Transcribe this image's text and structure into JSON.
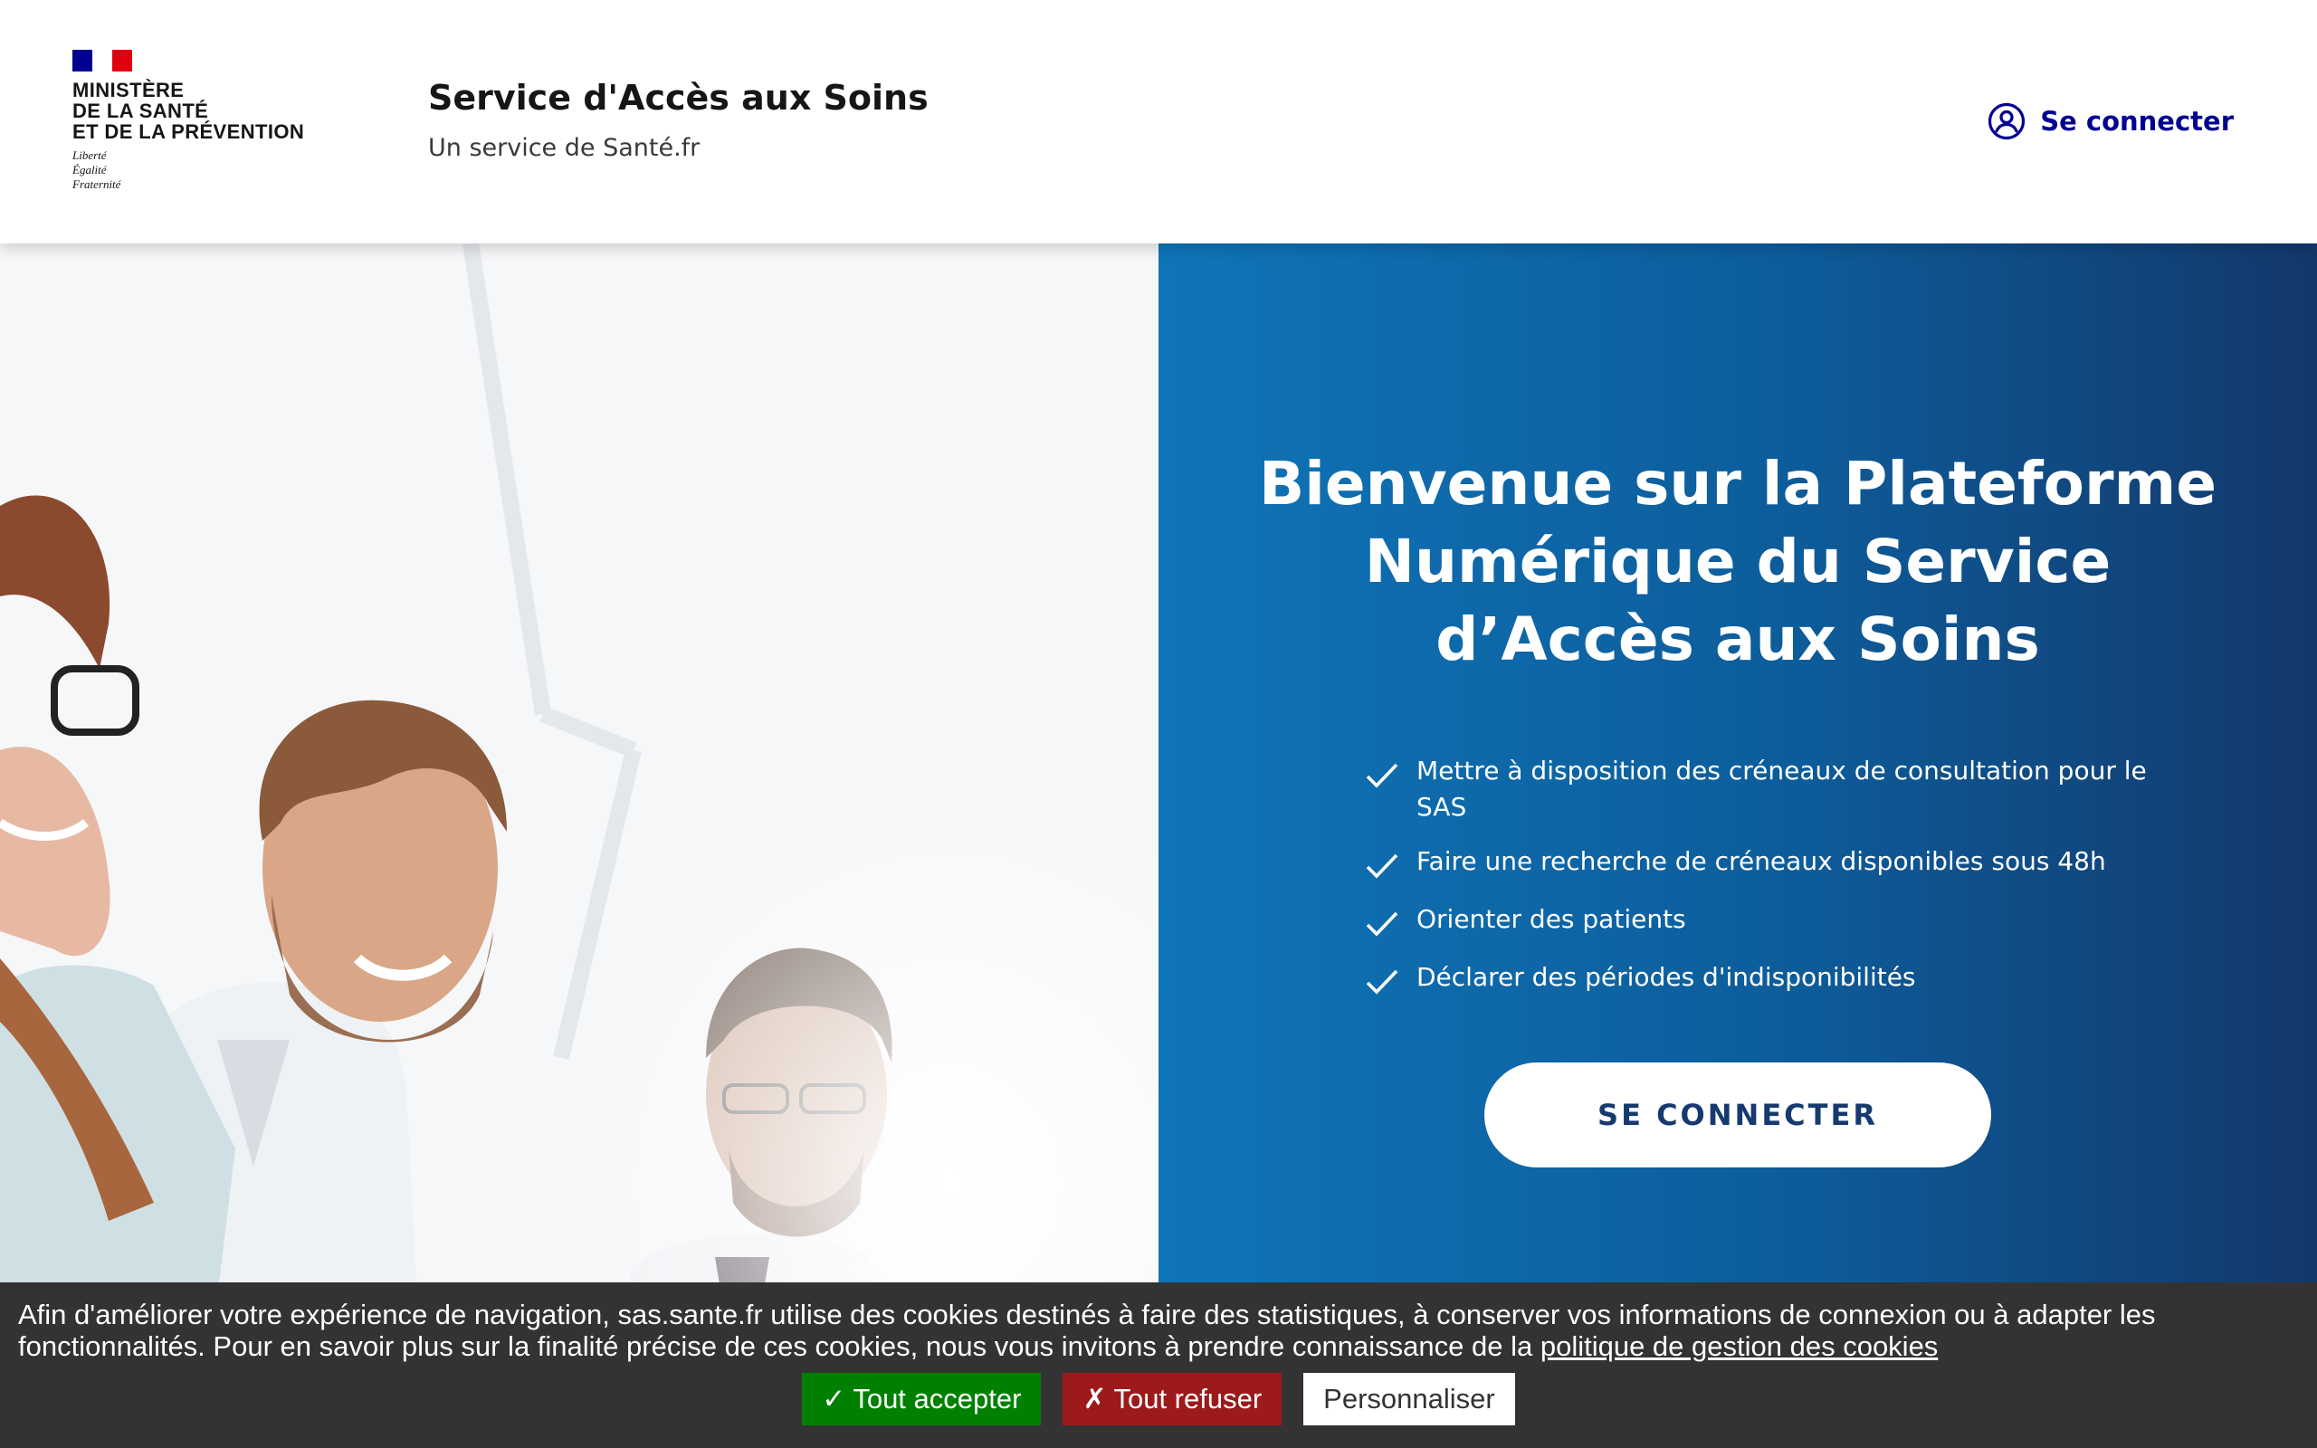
{
  "header": {
    "ministry_lines": [
      "MINISTÈRE",
      "DE LA SANTÉ",
      "ET DE LA PRÉVENTION"
    ],
    "motto_lines": [
      "Liberté",
      "Égalité",
      "Fraternité"
    ],
    "service_title": "Service d'Accès aux Soins",
    "service_tagline": "Un service de Santé.fr",
    "login_label": "Se connecter",
    "login_icon": "user-circle-icon"
  },
  "hero": {
    "title_lines": [
      "Bienvenue sur la Plateforme",
      "Numérique du Service",
      "d’Accès aux Soins"
    ],
    "features": [
      {
        "text": "Mettre à disposition des créneaux de consultation pour le SAS"
      },
      {
        "text": "Faire une recherche de créneaux disponibles sous 48h"
      },
      {
        "text": "Orienter des patients"
      },
      {
        "text": "Déclarer des périodes d'indisponibilités"
      }
    ],
    "feature_icon": "check-icon",
    "cta_label": "SE CONNECTER"
  },
  "cookie_banner": {
    "text": "Afin d'améliorer votre expérience de navigation, sas.sante.fr utilise des cookies destinés à faire des statistiques, à conserver vos informations de connexion ou à adapter les fonctionnalités. Pour en savoir plus sur la finalité précise de ces cookies, nous vous invitons à prendre connaissance de la ",
    "link_label": "politique de gestion des cookies",
    "accept_label": "✓ Tout accepter",
    "deny_label": "✗ Tout refuser",
    "customize_label": "Personnaliser"
  },
  "colors": {
    "brand_blue": "#000091",
    "panel_start": "#0f75b8",
    "panel_end": "#13386b",
    "accept_green": "#008000",
    "deny_red": "#9c1a1a",
    "banner_bg": "#333333"
  }
}
